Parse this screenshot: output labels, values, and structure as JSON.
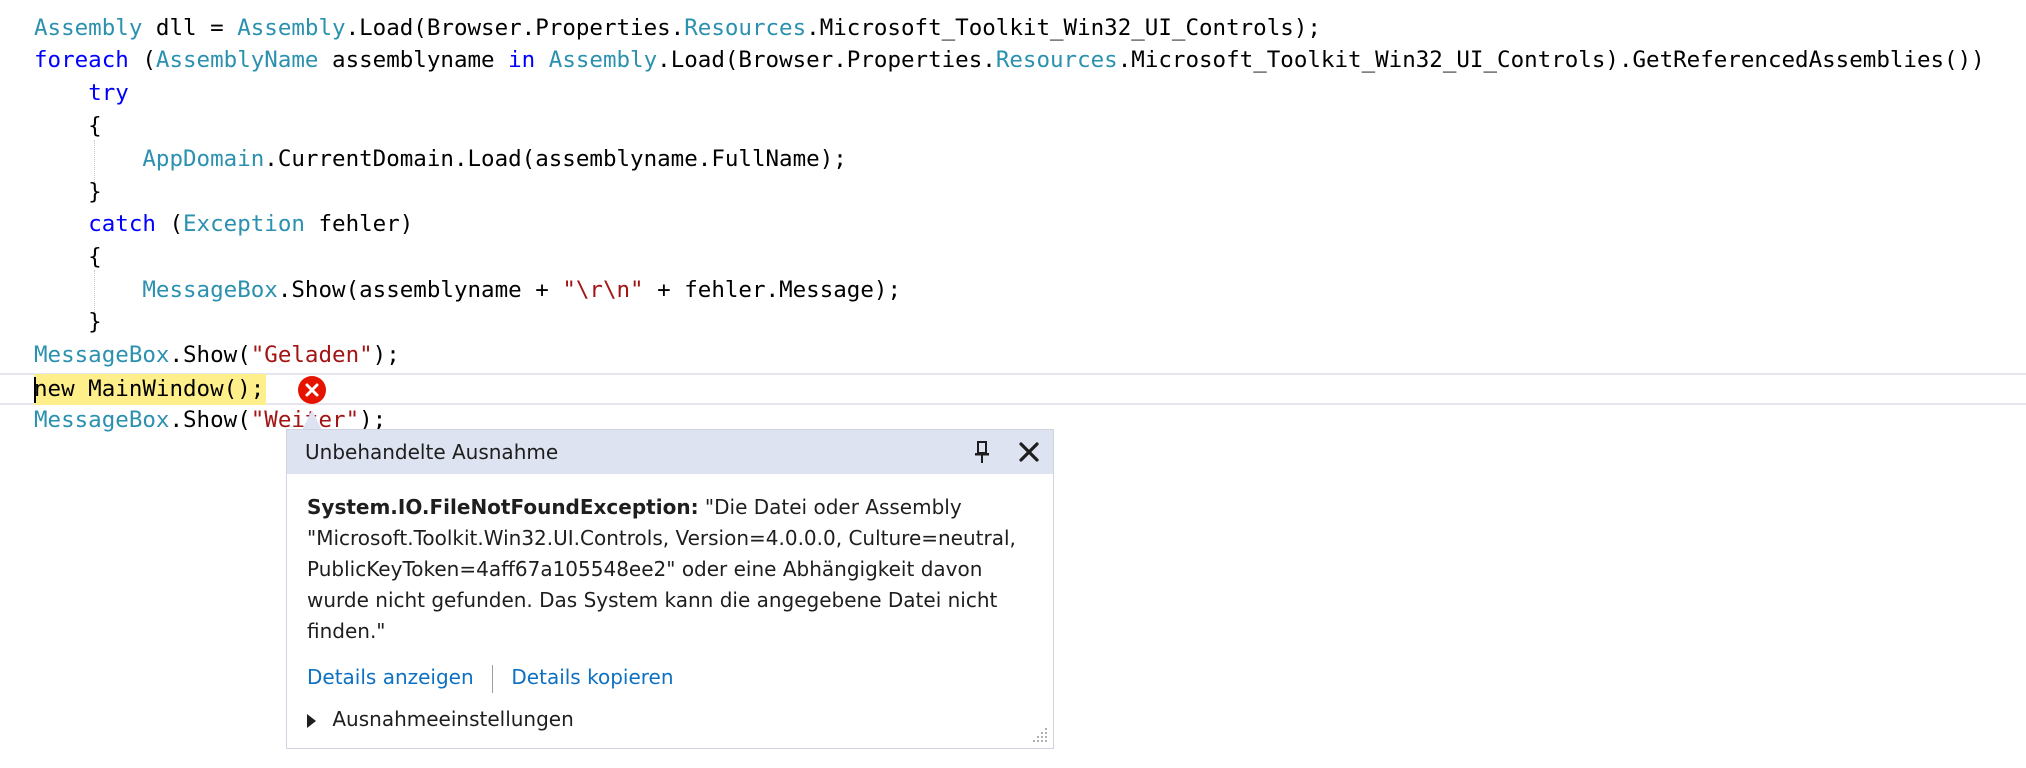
{
  "code_lines": [
    [
      "Assembly",
      " dll = ",
      "Assembly",
      ".Load(Browser.Properties.",
      "Resources",
      ".Microsoft_Toolkit_Win32_UI_Controls);"
    ],
    [
      "foreach",
      " (",
      "AssemblyName",
      " assemblyname ",
      "in",
      " ",
      "Assembly",
      ".Load(Browser.Properties.",
      "Resources",
      ".Microsoft_Toolkit_Win32_UI_Controls).GetReferencedAssemblies())"
    ],
    [
      "    ",
      "try"
    ],
    [
      "    {"
    ],
    [
      "        ",
      "AppDomain",
      ".CurrentDomain.Load(assemblyname.FullName);"
    ],
    [
      "    }"
    ],
    [
      "    ",
      "catch",
      " (",
      "Exception",
      " fehler)"
    ],
    [
      "    {"
    ],
    [
      "        ",
      "MessageBox",
      ".Show(assemblyname + ",
      "\"\\r\\n\"",
      " + fehler.Message);"
    ],
    [
      "    }"
    ],
    [
      "MessageBox",
      ".Show(",
      "\"Geladen\"",
      ");"
    ],
    [
      "new MainWindow();"
    ],
    [
      "MessageBox",
      ".Show(",
      "\"Weiter\"",
      ");"
    ]
  ],
  "exception_popup": {
    "title": "Unbehandelte Ausnahme",
    "exception_type": "System.IO.FileNotFoundException:",
    "message": "\"Die Datei oder Assembly \"Microsoft.Toolkit.Win32.UI.Controls, Version=4.0.0.0, Culture=neutral, PublicKeyToken=4aff67a105548ee2\" oder eine Abhängigkeit davon wurde nicht gefunden. Das System kann die angegebene Datei nicht finden.\"",
    "details_link": "Details anzeigen",
    "copy_details_link": "Details kopieren",
    "settings_label": "Ausnahmeeinstellungen"
  },
  "colors": {
    "keyword": "#0000ff",
    "type": "#2b91af",
    "string": "#a31515",
    "error": "#e51400",
    "link": "#0e70c0",
    "execution_highlight": "#ffef8a"
  },
  "icons": [
    "error-icon",
    "pin-icon",
    "close-icon",
    "expand-arrow-icon",
    "resize-grip-icon"
  ]
}
